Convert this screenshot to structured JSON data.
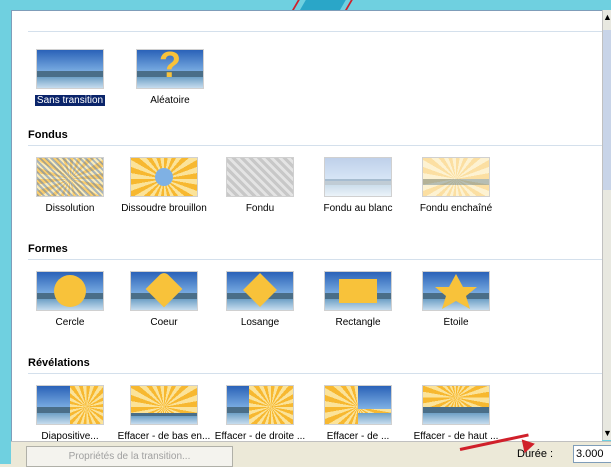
{
  "sections": {
    "top": {
      "items": [
        {
          "label": "Sans transition",
          "selected": true,
          "style": "plain"
        },
        {
          "label": "Aléatoire",
          "style": "question"
        }
      ]
    },
    "fondus": {
      "title": "Fondus",
      "items": [
        {
          "label": "Dissolution",
          "style": "dissolve"
        },
        {
          "label": "Dissoudre brouillon",
          "style": "sun"
        },
        {
          "label": "Fondu",
          "style": "grey"
        },
        {
          "label": "Fondu au blanc",
          "style": "white"
        },
        {
          "label": "Fondu enchaîné",
          "style": "sun-faded"
        }
      ]
    },
    "formes": {
      "title": "Formes",
      "items": [
        {
          "label": "Cercle",
          "style": "circle"
        },
        {
          "label": "Coeur",
          "style": "heart"
        },
        {
          "label": "Losange",
          "style": "diamond"
        },
        {
          "label": "Rectangle",
          "style": "rect"
        },
        {
          "label": "Étoile",
          "style": "star"
        }
      ]
    },
    "revelations": {
      "title": "Révélations",
      "items": [
        {
          "label": "Diapositive...",
          "style": "reveal-right"
        },
        {
          "label": "Effacer - de bas en...",
          "style": "reveal-bottom"
        },
        {
          "label": "Effacer - de droite ...",
          "style": "reveal-left"
        },
        {
          "label": "Effacer - de ...",
          "style": "reveal-right"
        },
        {
          "label": "Effacer - de haut ...",
          "style": "reveal-top"
        }
      ]
    }
  },
  "footer": {
    "properties_button": "Propriétés de la transition...",
    "duration_label": "Durée :",
    "duration_value": "3.000"
  },
  "colors": {
    "selection": "#0a246a",
    "accent_red": "#d0202a",
    "sun": "#f8c23a"
  }
}
